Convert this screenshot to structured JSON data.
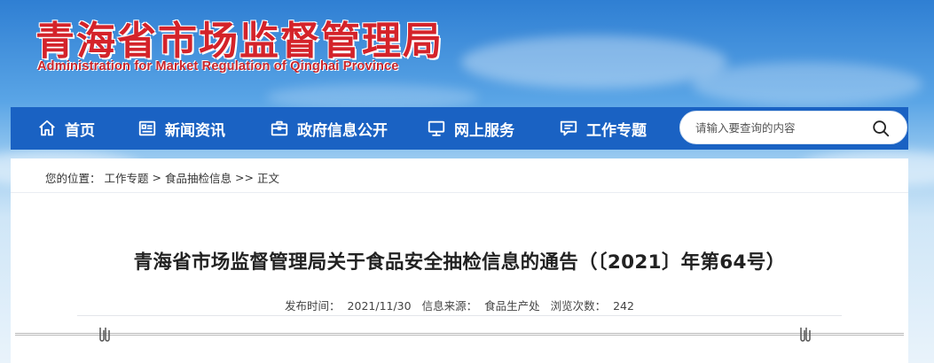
{
  "header": {
    "title": "青海省市场监督管理局",
    "subtitle": "Administration for Market Regulation of Qinghai Province"
  },
  "nav": {
    "items": [
      {
        "label": "首页",
        "icon": "home-icon"
      },
      {
        "label": "新闻资讯",
        "icon": "news-icon"
      },
      {
        "label": "政府信息公开",
        "icon": "briefcase-icon"
      },
      {
        "label": "网上服务",
        "icon": "monitor-icon"
      },
      {
        "label": "工作专题",
        "icon": "chat-icon"
      }
    ]
  },
  "search": {
    "placeholder": "请输入要查询的内容",
    "icon": "search-icon"
  },
  "breadcrumb": {
    "prefix": "您的位置：",
    "items": [
      "工作专题",
      "食品抽检信息",
      "正文"
    ],
    "sep1": ">",
    "sep2": ">>"
  },
  "article": {
    "title": "青海省市场监督管理局关于食品安全抽检信息的通告（〔2021〕年第64号）",
    "publish_label": "发布时间：",
    "publish_date": "2021/11/30",
    "source_label": "信息来源：",
    "source": "食品生产处",
    "views_label": "浏览次数：",
    "views": "242"
  },
  "colors": {
    "nav_bg": "#1a62c3",
    "title_red": "#d4232a"
  }
}
